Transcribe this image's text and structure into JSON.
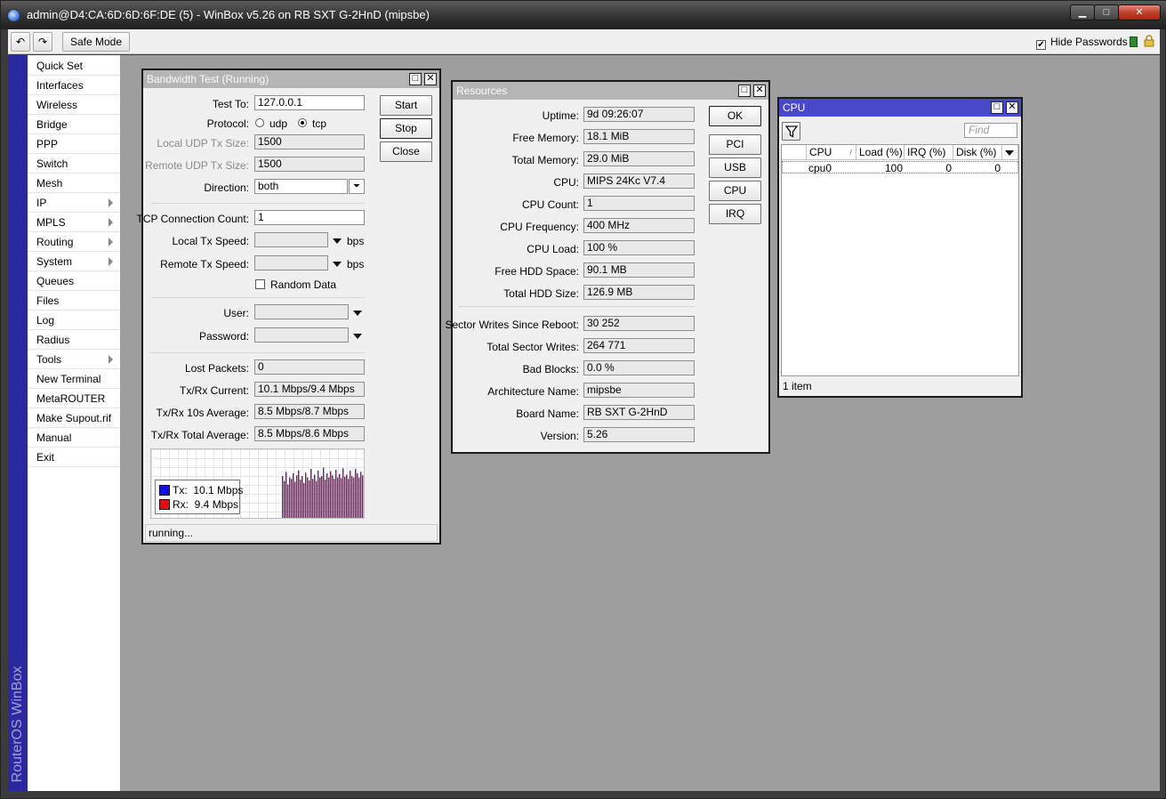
{
  "app": {
    "title": "admin@D4:CA:6D:6D:6F:DE (5) - WinBox v5.26 on RB SXT G-2HnD (mipsbe)",
    "brand": "RouterOS WinBox",
    "window_controls": {
      "min": "▁",
      "max": "□",
      "close": "✕"
    }
  },
  "toolbar": {
    "undo_icon": "↶",
    "redo_icon": "↷",
    "safe_mode_label": "Safe Mode",
    "hide_passwords_label": "Hide Passwords",
    "hide_passwords_checked": "✔",
    "status_color": "#2c8a2c"
  },
  "sidebar": {
    "items": [
      {
        "label": "Quick Set",
        "submenu": false
      },
      {
        "label": "Interfaces",
        "submenu": false
      },
      {
        "label": "Wireless",
        "submenu": false
      },
      {
        "label": "Bridge",
        "submenu": false
      },
      {
        "label": "PPP",
        "submenu": false
      },
      {
        "label": "Switch",
        "submenu": false
      },
      {
        "label": "Mesh",
        "submenu": false
      },
      {
        "label": "IP",
        "submenu": true
      },
      {
        "label": "MPLS",
        "submenu": true
      },
      {
        "label": "Routing",
        "submenu": true
      },
      {
        "label": "System",
        "submenu": true
      },
      {
        "label": "Queues",
        "submenu": false
      },
      {
        "label": "Files",
        "submenu": false
      },
      {
        "label": "Log",
        "submenu": false
      },
      {
        "label": "Radius",
        "submenu": false
      },
      {
        "label": "Tools",
        "submenu": true
      },
      {
        "label": "New Terminal",
        "submenu": false
      },
      {
        "label": "MetaROUTER",
        "submenu": false
      },
      {
        "label": "Make Supout.rif",
        "submenu": false
      },
      {
        "label": "Manual",
        "submenu": false
      },
      {
        "label": "Exit",
        "submenu": false
      }
    ]
  },
  "bandwidth_test": {
    "title": "Bandwidth Test (Running)",
    "test_to_label": "Test To:",
    "test_to_value": "127.0.0.1",
    "protocol_label": "Protocol:",
    "protocol_udp": "udp",
    "protocol_tcp": "tcp",
    "protocol_selected": "tcp",
    "local_udp_tx_size_label": "Local UDP Tx Size:",
    "local_udp_tx_size_value": "1500",
    "remote_udp_tx_size_label": "Remote UDP Tx Size:",
    "remote_udp_tx_size_value": "1500",
    "direction_label": "Direction:",
    "direction_value": "both",
    "tcp_conn_count_label": "TCP Connection Count:",
    "tcp_conn_count_value": "1",
    "local_tx_speed_label": "Local Tx Speed:",
    "remote_tx_speed_label": "Remote Tx Speed:",
    "bps_unit": "bps",
    "random_data_label": "Random Data",
    "user_label": "User:",
    "password_label": "Password:",
    "lost_packets_label": "Lost Packets:",
    "lost_packets_value": "0",
    "txrx_current_label": "Tx/Rx Current:",
    "txrx_current_value": "10.1 Mbps/9.4 Mbps",
    "txrx_10s_label": "Tx/Rx 10s Average:",
    "txrx_10s_value": "8.5 Mbps/8.7 Mbps",
    "txrx_total_label": "Tx/Rx Total Average:",
    "txrx_total_value": "8.5 Mbps/8.6 Mbps",
    "buttons": {
      "start": "Start",
      "stop": "Stop",
      "close": "Close"
    },
    "legend": {
      "tx_label": "Tx:",
      "tx_value": "10.1 Mbps",
      "tx_color": "#1010e0",
      "rx_label": "Rx:",
      "rx_value": "9.4 Mbps",
      "rx_color": "#e01010"
    },
    "status": "running..."
  },
  "chart_data": {
    "type": "bar",
    "title": "",
    "xlabel": "",
    "ylabel": "",
    "ylim": [
      0,
      1
    ],
    "series": [
      {
        "color": "#7a1a6e",
        "values": [
          0.62,
          0.55,
          0.68,
          0.5,
          0.6,
          0.58,
          0.66,
          0.54,
          0.63,
          0.7,
          0.57,
          0.62,
          0.52,
          0.67,
          0.6,
          0.56,
          0.72,
          0.58,
          0.64,
          0.55,
          0.7,
          0.6,
          0.62,
          0.74,
          0.57,
          0.66,
          0.6,
          0.69,
          0.63,
          0.58,
          0.71,
          0.6,
          0.65,
          0.59,
          0.73,
          0.61,
          0.64,
          0.58,
          0.7,
          0.62,
          0.6,
          0.72,
          0.66,
          0.6,
          0.68,
          0.63,
          0.7
        ]
      }
    ]
  },
  "resources": {
    "title": "Resources",
    "rows": [
      {
        "label": "Uptime:",
        "value": "9d 09:26:07"
      },
      {
        "label": "Free Memory:",
        "value": "18.1 MiB"
      },
      {
        "label": "Total Memory:",
        "value": "29.0 MiB"
      },
      {
        "label": "CPU:",
        "value": "MIPS 24Kc V7.4"
      },
      {
        "label": "CPU Count:",
        "value": "1"
      },
      {
        "label": "CPU Frequency:",
        "value": "400 MHz"
      },
      {
        "label": "CPU Load:",
        "value": "100 %"
      },
      {
        "label": "Free HDD Space:",
        "value": "90.1 MB"
      },
      {
        "label": "Total HDD Size:",
        "value": "126.9 MB"
      }
    ],
    "rows2": [
      {
        "label": "Sector Writes Since Reboot:",
        "value": "30 252"
      },
      {
        "label": "Total Sector Writes:",
        "value": "264 771"
      },
      {
        "label": "Bad Blocks:",
        "value": "0.0 %"
      },
      {
        "label": "Architecture Name:",
        "value": "mipsbe"
      },
      {
        "label": "Board Name:",
        "value": "RB SXT G-2HnD"
      },
      {
        "label": "Version:",
        "value": "5.26"
      }
    ],
    "buttons": {
      "ok": "OK",
      "pci": "PCI",
      "usb": "USB",
      "cpu": "CPU",
      "irq": "IRQ"
    }
  },
  "cpu_window": {
    "title": "CPU",
    "find_placeholder": "Find",
    "filter_icon": "filter-icon",
    "columns": [
      "CPU",
      "Load (%)",
      "IRQ (%)",
      "Disk (%)"
    ],
    "sort_indicator": "/",
    "rows": [
      {
        "cpu": "cpu0",
        "load": "100",
        "irq": "0",
        "disk": "0"
      }
    ],
    "count": "1 item"
  }
}
